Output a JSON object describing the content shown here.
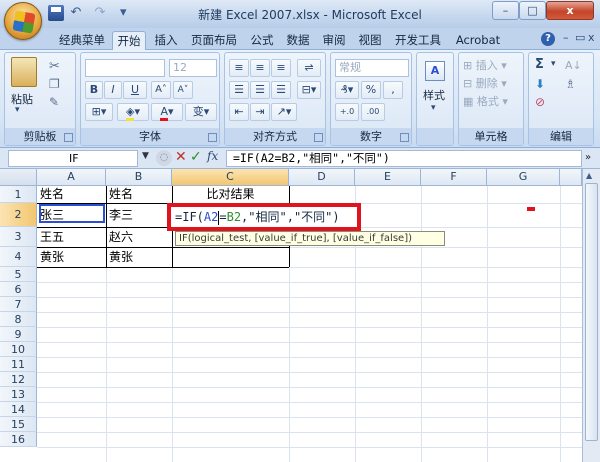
{
  "window": {
    "title": "新建 Excel 2007.xlsx - Microsoft Excel",
    "minimize": "–",
    "maximize": "□",
    "close": "x"
  },
  "qat": {
    "undo": "↶",
    "redo": "↷"
  },
  "tabs": [
    {
      "label": "经典菜单"
    },
    {
      "label": "开始"
    },
    {
      "label": "插入"
    },
    {
      "label": "页面布局"
    },
    {
      "label": "公式"
    },
    {
      "label": "数据"
    },
    {
      "label": "审阅"
    },
    {
      "label": "视图"
    },
    {
      "label": "开发工具"
    },
    {
      "label": "Acrobat"
    }
  ],
  "tab_controls": {
    "help": "?",
    "minimize": "–",
    "restore": "▭",
    "close": "x"
  },
  "ribbon": {
    "groups": [
      {
        "label": "剪贴板"
      },
      {
        "label": "字体"
      },
      {
        "label": "对齐方式"
      },
      {
        "label": "数字"
      },
      {
        "label": ""
      },
      {
        "label": "单元格"
      },
      {
        "label": "编辑"
      }
    ],
    "clipboard": {
      "paste": "粘贴"
    },
    "font": {
      "size": "12",
      "bold": "B",
      "italic": "I",
      "underline": "U",
      "grow": "A˄",
      "shrink": "A˅",
      "phonetic": "变"
    },
    "number": {
      "format": "常规",
      "percent": "%",
      "comma": ",",
      "inc": "+.0",
      "dec": ".00"
    },
    "styles": {
      "label": "样式",
      "icon": "A"
    },
    "cells": {
      "insert": "插入",
      "delete": "删除",
      "format": "格式"
    },
    "editing": {
      "sum": "Σ",
      "sort": "A↓",
      "find": "♗",
      "clear": "⊘"
    }
  },
  "formula_bar": {
    "name_box": "IF",
    "fx": "fx",
    "formula": "=IF(A2=B2,\"相同\",\"不同\")"
  },
  "grid": {
    "columns": [
      "A",
      "B",
      "C",
      "D",
      "E",
      "F",
      "G"
    ],
    "rows": [
      "1",
      "2",
      "3",
      "4",
      "5",
      "6",
      "7",
      "8",
      "9",
      "10",
      "11",
      "12",
      "13",
      "14",
      "15",
      "16"
    ],
    "cells": {
      "A1": "姓名",
      "B1": "姓名",
      "C1": "比对结果",
      "A2": "张三",
      "B2": "李三",
      "A3": "王五",
      "B3": "赵六",
      "A4": "黄张",
      "B4": "黄张"
    },
    "edit": {
      "prefix": "=IF(",
      "ref1": "A2",
      "eq": "=",
      "ref2": "B2",
      "rest": ",\"相同\",\"不同\")"
    },
    "tooltip": "IF(logical_test, [value_if_true], [value_if_false])"
  },
  "colors": {
    "highlight_red": "#e0141e",
    "ref_blue": "#2a4fd0",
    "ref_green": "#2f8f2f"
  }
}
